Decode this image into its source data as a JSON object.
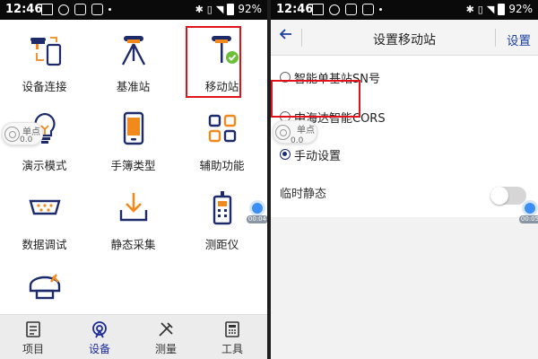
{
  "left_screen": {
    "statusbar": {
      "time": "12:46",
      "battery": "92%"
    },
    "grid_items": [
      {
        "label": "设备连接",
        "icon": "device-connect-icon"
      },
      {
        "label": "基准站",
        "icon": "base-station-icon"
      },
      {
        "label": "移动站",
        "icon": "rover-icon"
      },
      {
        "label": "演示模式",
        "icon": "lightbulb-icon"
      },
      {
        "label": "手簿类型",
        "icon": "handheld-icon"
      },
      {
        "label": "辅助功能",
        "icon": "apps-grid-icon"
      },
      {
        "label": "数据调试",
        "icon": "serial-port-icon"
      },
      {
        "label": "静态采集",
        "icon": "download-tray-icon"
      },
      {
        "label": "测距仪",
        "icon": "rangefinder-icon"
      },
      {
        "label": "",
        "icon": "receiver-settings-icon"
      }
    ],
    "float_widget": {
      "title": "单点",
      "value": "0.0"
    },
    "side_bubble": {
      "time": "00:04"
    },
    "bottom_nav": [
      {
        "label": "项目",
        "icon": "project-icon",
        "active": false
      },
      {
        "label": "设备",
        "icon": "device-icon",
        "active": true
      },
      {
        "label": "测量",
        "icon": "survey-icon",
        "active": false
      },
      {
        "label": "工具",
        "icon": "calculator-icon",
        "active": false
      }
    ]
  },
  "right_screen": {
    "statusbar": {
      "time": "12:46",
      "battery": "92%"
    },
    "titlebar": {
      "title": "设置移动站",
      "action": "设置"
    },
    "radio_options": [
      {
        "label": "智能单基站SN号",
        "checked": false
      },
      {
        "label": "中海达智能CORS",
        "checked": false
      },
      {
        "label": "手动设置",
        "checked": true
      }
    ],
    "toggle": {
      "label": "临时静态",
      "on": false
    },
    "float_widget": {
      "title": "单点",
      "value": "0.0"
    },
    "side_bubble": {
      "time": "00:05"
    }
  },
  "colors": {
    "accent_blue": "#1a3fa0",
    "highlight_red": "#e0121a",
    "icon_navy": "#1d2b6b",
    "icon_orange": "#f08a1c",
    "ok_green": "#6dbf3a"
  }
}
